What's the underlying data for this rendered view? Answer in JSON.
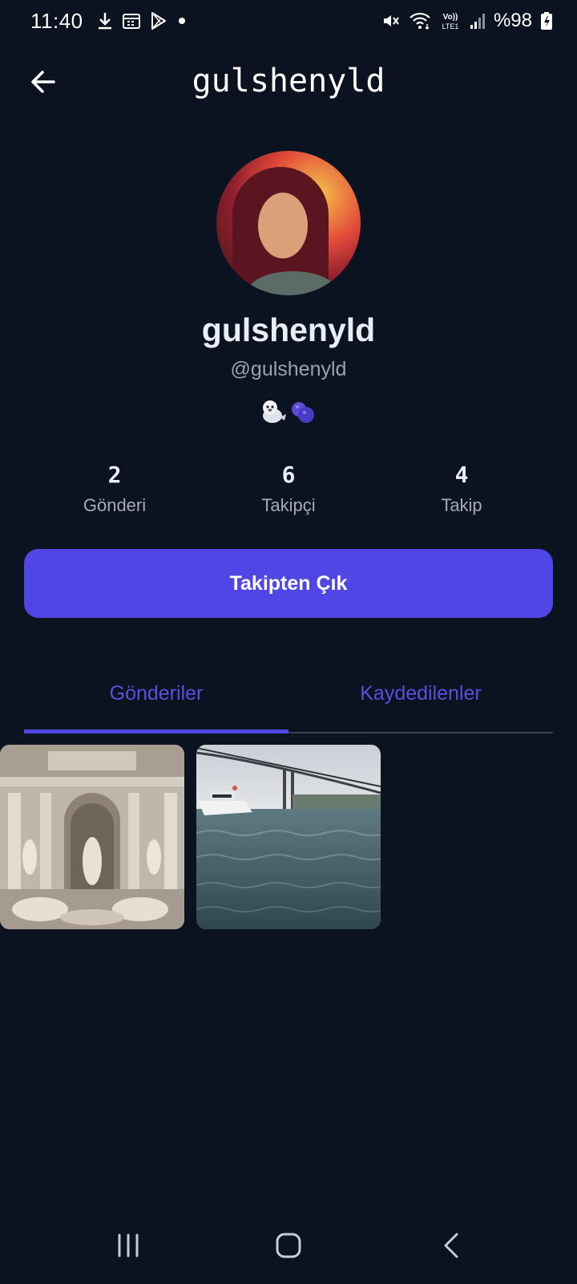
{
  "status_bar": {
    "time": "11:40",
    "battery": "%98",
    "icons": [
      "download-icon",
      "calendar-icon",
      "play-store-icon",
      "dot-icon",
      "mute-icon",
      "wifi-icon",
      "volte-icon",
      "signal-icon",
      "battery-charging-icon"
    ]
  },
  "header": {
    "title": "gulshenyld",
    "back_icon": "arrow-left-icon"
  },
  "profile": {
    "display_name": "gulshenyld",
    "handle": "@gulshenyld",
    "emojis": [
      "seal-emoji",
      "blueberries-emoji"
    ]
  },
  "stats": {
    "posts": {
      "value": "2",
      "label": "Gönderi"
    },
    "followers": {
      "value": "6",
      "label": "Takipçi"
    },
    "following": {
      "value": "4",
      "label": "Takip"
    }
  },
  "unfollow_button": "Takipten Çık",
  "tabs": {
    "posts": "Gönderiler",
    "saved": "Kaydedilenler",
    "active": "posts"
  },
  "posts_grid": {
    "items": [
      "post-trevi-fountain",
      "post-bosphorus-bridge"
    ]
  },
  "colors": {
    "background": "#0b1220",
    "accent": "#4f46e5",
    "tab_text": "#5750e0",
    "muted_text": "#9aa3b4"
  },
  "nav_bar": {
    "icons": [
      "recent-apps-icon",
      "home-icon",
      "back-icon"
    ]
  }
}
